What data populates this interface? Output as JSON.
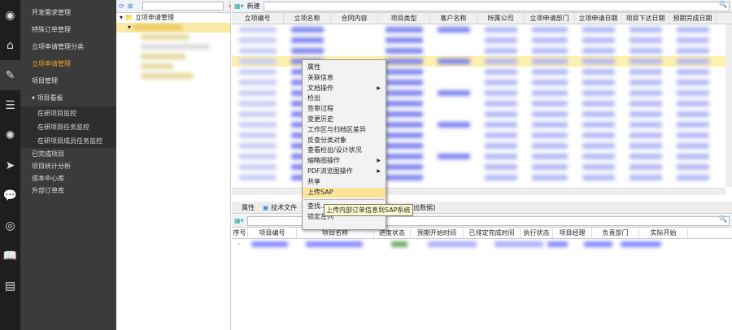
{
  "iconbar": [
    "eye-icon",
    "home-icon",
    "edit-icon",
    "database-icon",
    "loading-icon",
    "send-icon",
    "chat-icon",
    "broadcast-icon",
    "book-icon",
    "id-card-icon"
  ],
  "menu": {
    "items": [
      "开发需求管理",
      "特殊订单管理",
      "立项申请管理分类",
      "立项申请管理",
      "项目管理"
    ],
    "group": "项目看板",
    "sub": [
      "在研项目监控",
      "在研项目任务监控",
      "在研项目成员任务监控"
    ],
    "more": [
      "已完成项目",
      "项目统计分析",
      "成本中心库",
      "外部订单库"
    ]
  },
  "tree": {
    "root": "立项申请管理"
  },
  "top": {
    "new_label": "新建",
    "columns": [
      "立项编号",
      "立项名称",
      "合同内容",
      "项目类型",
      "客户名称",
      "所属公司",
      "立项申请部门",
      "立项申请日期",
      "项目下达日期",
      "预期完成日期"
    ]
  },
  "bottom": {
    "tabs": [
      "属性",
      "技术文件",
      "[输出数据]"
    ],
    "columns": [
      "序号",
      "项目编号",
      "项目名称",
      "进度状态",
      "预期开始时间",
      "已排定完成时间",
      "执行状态",
      "项目经理",
      "负责部门",
      "实际开始"
    ]
  },
  "context_menu": [
    {
      "label": "属性"
    },
    {
      "label": "关联信息"
    },
    {
      "label": "文档操作",
      "sub": true
    },
    {
      "label": "检出"
    },
    {
      "label": "签审过程"
    },
    {
      "label": "变更历史"
    },
    {
      "label": "工作区与归档区差异"
    },
    {
      "label": "反查分类对象"
    },
    {
      "label": "查看检出/设计状况"
    },
    {
      "label": "缩略图操作",
      "sub": true
    },
    {
      "label": "PDF浏览图操作",
      "sub": true
    },
    {
      "label": "共享"
    },
    {
      "label": "上传SAP",
      "highlight": true
    },
    {
      "label": "查找..."
    },
    {
      "label": "锁定左列"
    }
  ],
  "tooltip": "上传内部订单信息到SAP系统"
}
